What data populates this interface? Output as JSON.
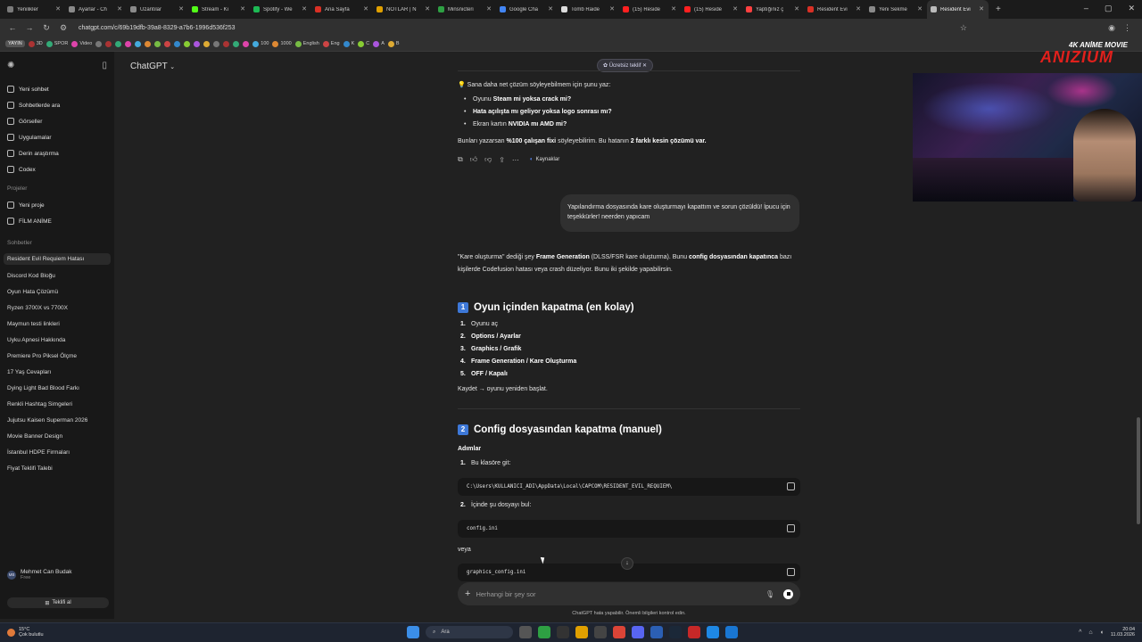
{
  "browser": {
    "tabs": [
      {
        "label": "Yenilikler",
        "color": "#7a7a7a"
      },
      {
        "label": "Ayarlar - Ch",
        "color": "#8a8a8a"
      },
      {
        "label": "Uzantılar",
        "color": "#8a8a8a"
      },
      {
        "label": "Stream - Ki",
        "color": "#53fc18"
      },
      {
        "label": "Spotify - We",
        "color": "#1db954"
      },
      {
        "label": "Ana Sayfa",
        "color": "#d93025"
      },
      {
        "label": "NOTLAR | N",
        "color": "#e0a000"
      },
      {
        "label": "Minsnicteri",
        "color": "#2ea043"
      },
      {
        "label": "Google Cha",
        "color": "#4285f4"
      },
      {
        "label": "Tomb Raide",
        "color": "#dddddd"
      },
      {
        "label": "(15) Reside",
        "color": "#ff2020"
      },
      {
        "label": "(15) Reside",
        "color": "#ff2020"
      },
      {
        "label": "Yaptığınız ç",
        "color": "#ff4040"
      },
      {
        "label": "Resident Evi",
        "color": "#d93025"
      },
      {
        "label": "Yeni Sekme",
        "color": "#8a8a8a"
      },
      {
        "label": "Resident Evi",
        "color": "#bbbbbb",
        "active": true
      }
    ],
    "url": "chatgpt.com/c/69b19dfb-39a8-8329-a7b6-1996d536f253",
    "bookmarks": [
      "YAYIN",
      "3D",
      "SPOR",
      "Video",
      "100",
      "1000",
      "English",
      "Eng",
      "K",
      "C",
      "A",
      "B"
    ]
  },
  "sidebar": {
    "nav": [
      {
        "label": "Yeni sohbet",
        "icon": "new-chat-icon"
      },
      {
        "label": "Sohbetlerde ara",
        "icon": "search-icon"
      },
      {
        "label": "Görseller",
        "icon": "image-icon"
      },
      {
        "label": "Uygulamalar",
        "icon": "apps-icon"
      },
      {
        "label": "Derin araştırma",
        "icon": "telescope-icon"
      },
      {
        "label": "Codex",
        "icon": "codex-icon"
      }
    ],
    "projects_label": "Projeler",
    "projects": [
      {
        "label": "Yeni proje",
        "icon": "folder-plus-icon"
      },
      {
        "label": "FİLM ANİME",
        "icon": "folder-icon"
      }
    ],
    "chats_label": "Sohbetler",
    "chats": [
      "Resident Evil Requiem Hatası",
      "Discord Kod Bloğu",
      "Oyun Hata Çözümü",
      "Ryzen 3700X vs 7700X",
      "Maymun testi linkleri",
      "Uyku Apnesi Hakkında",
      "Premiere Pro Piksel Ölçme",
      "17 Yaş Cevapları",
      "Dying Light Bad Blood Farkı",
      "Renkli Hashtag Simgeleri",
      "Jujutsu Kaisen Superman 2026",
      "Movie Banner Design",
      "İstanbul HDPE Firmaları",
      "Fiyat Teklifi Talebi"
    ],
    "user": {
      "initials": "MB",
      "name": "Mehmet Can Budak",
      "plan": "Free"
    },
    "upgrade_label": "Teklifi al"
  },
  "main": {
    "model": "ChatGPT",
    "free_offer": "Ücretsiz teklif",
    "intro_prefix": "Sana daha net çözüm söyleyebilmem için şunu yaz:",
    "bullets": [
      {
        "pre": "Oyunu ",
        "bold": "Steam mi yoksa crack mi?",
        "post": ""
      },
      {
        "pre": "",
        "bold": "Hata açılışta mı geliyor yoksa logo sonrası mı?",
        "post": ""
      },
      {
        "pre": "Ekran kartın ",
        "bold": "NVIDIA mı AMD mi?",
        "post": ""
      }
    ],
    "closing_pre": "Bunları yazarsan ",
    "closing_b1": "%100 çalışan fixi",
    "closing_mid": " söyleyebilirim. Bu hatanın ",
    "closing_b2": "2 farklı kesin çözümü var.",
    "sources_label": "Kaynaklar",
    "user_message": "Yapılandırma dosyasında kare oluşturmayı kapattım ve sorun çözüldü! İpucu için teşekkürler! neerden yapıcam",
    "answer_pre": "\"Kare oluşturma\" dediği şey ",
    "answer_b1": "Frame Generation",
    "answer_mid": " (DLSS/FSR kare oluşturma). Bunu ",
    "answer_b2": "config dosyasından kapatınca",
    "answer_post": " bazı kişilerde Codefusion hatası veya crash düzeliyor. Bunu iki şekilde yapabilirsin.",
    "section1": {
      "badge": "1",
      "title": "Oyun içinden kapatma (en kolay)",
      "steps": [
        {
          "n": "1.",
          "text": "Oyunu aç",
          "bold": false
        },
        {
          "n": "2.",
          "text": "Options / Ayarlar",
          "bold": true
        },
        {
          "n": "3.",
          "text": "Graphics / Grafik",
          "bold": true
        },
        {
          "n": "4.",
          "text": "Frame Generation / Kare Oluşturma",
          "bold": true
        },
        {
          "n": "5.",
          "text": "OFF / Kapalı",
          "bold": true
        }
      ],
      "footer": "Kaydet → oyunu yeniden başlat."
    },
    "section2": {
      "badge": "2",
      "title": "Config dosyasından kapatma (manuel)",
      "subheading": "Adımlar",
      "step1": {
        "n": "1.",
        "text": "Bu klasöre git:"
      },
      "path": "C:\\Users\\KULLANICI_ADI\\AppData\\Local\\CAPCOM\\RESIDENT_EVIL_REQUIEM\\",
      "step2": {
        "n": "2.",
        "text": "İçinde şu dosyayı bul:"
      },
      "file1": "config.ini",
      "or": "veya",
      "file2": "graphics_config.ini"
    },
    "composer_placeholder": "Herhangi bir şey sor",
    "disclaimer": "ChatGPT hata yapabilir. Önemli bilgileri kontrol edin."
  },
  "overlay": {
    "brand_top": "4K ANİME MOVIE",
    "brand_name": "ANIZIUM"
  },
  "taskbar": {
    "temp": "15°C",
    "weather": "Çok bulutlu",
    "search": "Ara",
    "time": "20:04",
    "date": "11.03.2026"
  }
}
